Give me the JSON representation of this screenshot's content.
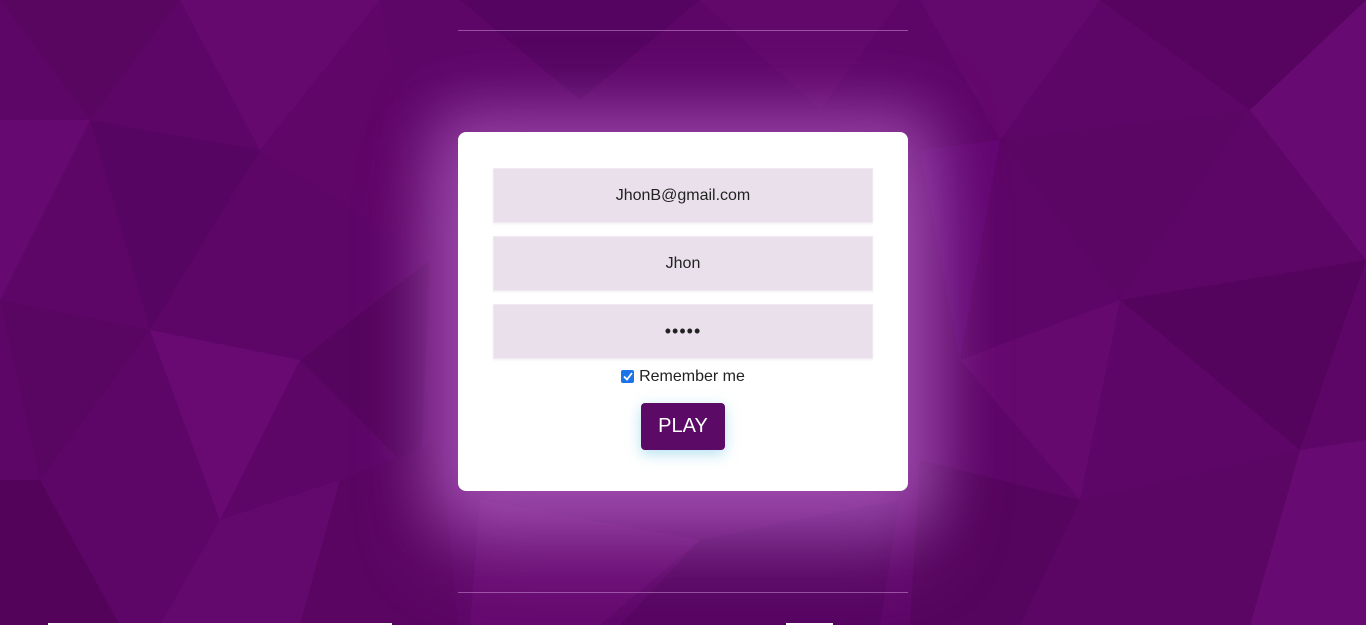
{
  "form": {
    "email_value": "JhonB@gmail.com",
    "name_value": "Jhon",
    "password_value": "•••••",
    "remember_label": "Remember me",
    "remember_checked": true,
    "play_label": "PLAY"
  },
  "colors": {
    "background": "#5e0668",
    "card": "#ffffff",
    "field_bg": "#eae0ec",
    "button": "#5b0a66",
    "checkbox": "#1a73e8"
  }
}
